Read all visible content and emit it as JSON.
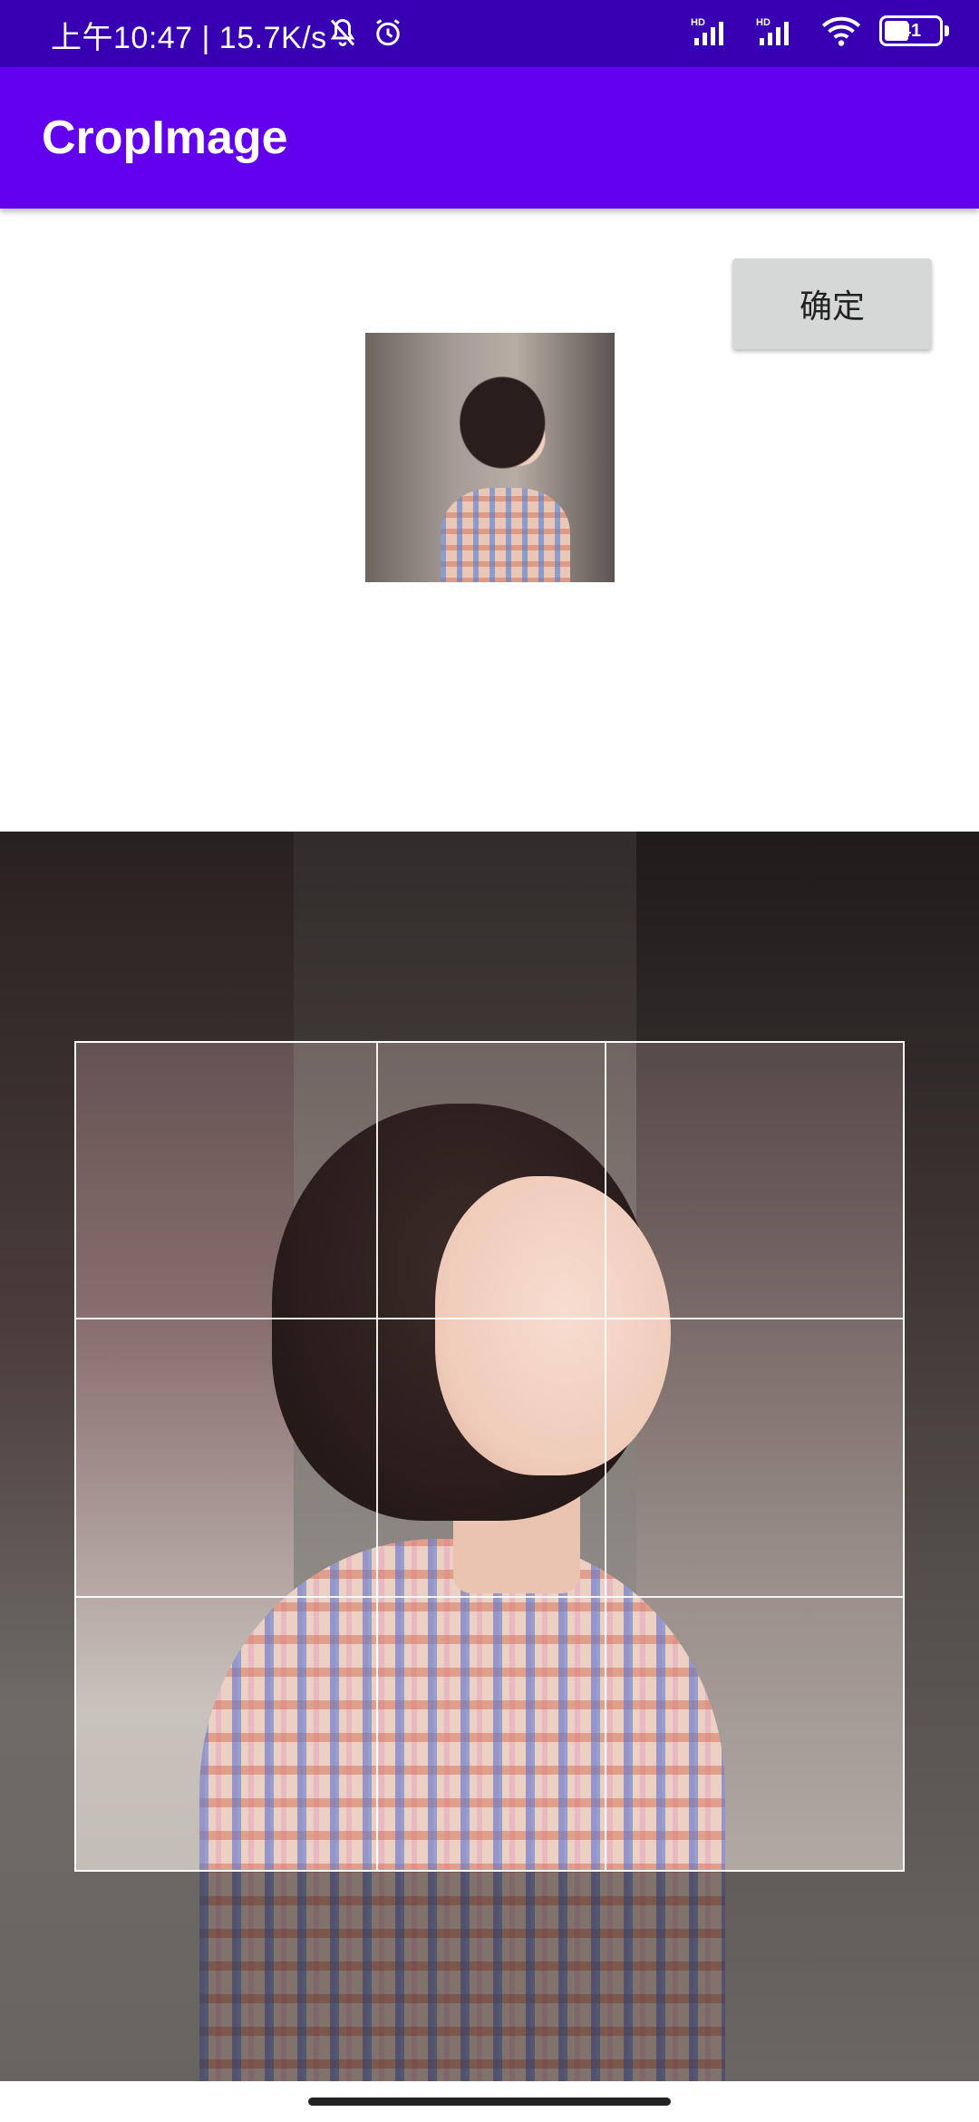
{
  "status_bar": {
    "time_speed": "上午10:47 | 15.7K/s",
    "battery": "41",
    "net_label_1": "HD",
    "net_label_2": "HD"
  },
  "app_bar": {
    "title": "CropImage"
  },
  "actions": {
    "confirm_label": "确定"
  },
  "colors": {
    "status_bar": "#3700b3",
    "app_bar": "#6200ee",
    "button_bg": "#d6d7d7"
  }
}
